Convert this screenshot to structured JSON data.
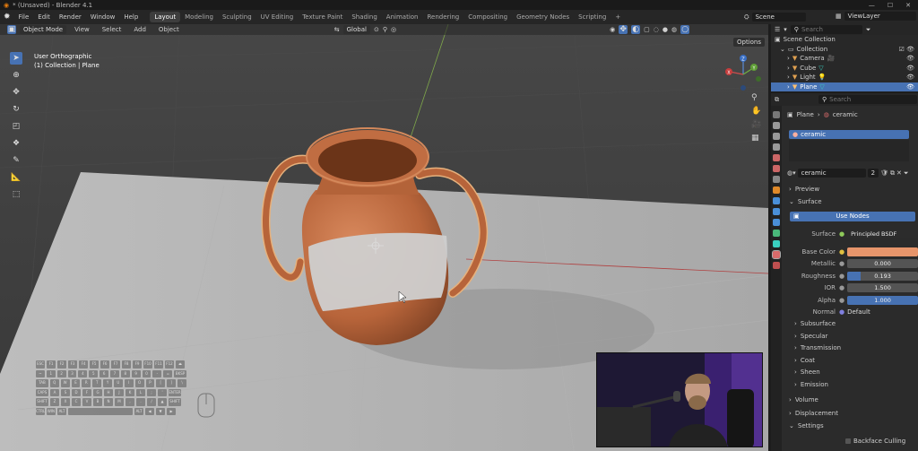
{
  "window": {
    "title": "* (Unsaved) - Blender 4.1",
    "controls": [
      "—",
      "☐",
      "✕"
    ]
  },
  "menu": [
    "File",
    "Edit",
    "Render",
    "Window",
    "Help"
  ],
  "workspaces": [
    "Layout",
    "Modeling",
    "Sculpting",
    "UV Editing",
    "Texture Paint",
    "Shading",
    "Animation",
    "Rendering",
    "Compositing",
    "Geometry Nodes",
    "Scripting"
  ],
  "workspace_add": "+",
  "scene": {
    "name": "Scene",
    "view_layer": "ViewLayer"
  },
  "viewport_header": {
    "mode": "Object Mode",
    "menus": [
      "View",
      "Select",
      "Add",
      "Object"
    ],
    "orientation": "Global",
    "options": "Options"
  },
  "viewport_overlay": {
    "view": "User Orthographic",
    "collection": "(1) Collection | Plane"
  },
  "gizmo": {
    "x": "X",
    "y": "Y",
    "z": "Z"
  },
  "outliner": {
    "search_placeholder": "Search",
    "root": "Scene Collection",
    "collection": "Collection",
    "items": [
      "Camera",
      "Cube",
      "Light",
      "Plane"
    ]
  },
  "properties": {
    "search_placeholder": "Search",
    "breadcrumb_object": "Plane",
    "breadcrumb_material": "ceramic",
    "slot_name": "ceramic",
    "material_name": "ceramic",
    "user_count": "2",
    "preview": "Preview",
    "surface": "Surface",
    "use_nodes": "Use Nodes",
    "surface_label": "Surface",
    "surface_shader": "Principled BSDF",
    "fields": [
      {
        "label": "Base Color",
        "value": "",
        "fill": 1.0
      },
      {
        "label": "Metallic",
        "value": "0.000",
        "fill": 0.0
      },
      {
        "label": "Roughness",
        "value": "0.193",
        "fill": 0.193
      },
      {
        "label": "IOR",
        "value": "1.500",
        "fill": 0.0
      },
      {
        "label": "Alpha",
        "value": "1.000",
        "fill": 1.0
      }
    ],
    "normal_label": "Normal",
    "normal_value": "Default",
    "subpanels": [
      "Subsurface",
      "Specular",
      "Transmission",
      "Coat",
      "Sheen",
      "Emission"
    ],
    "sections": [
      "Volume",
      "Displacement",
      "Settings"
    ],
    "backface": "Backface Culling"
  },
  "colors": {
    "accent": "#4772b3",
    "base_color": "#e7956b",
    "vase": "#b7643a"
  },
  "keyboard": [
    [
      "ESC",
      "F1",
      "F2",
      "F3",
      "F4",
      "F5",
      "F6",
      "F7",
      "F8",
      "F9",
      "F10",
      "F11",
      "F12",
      "⏏"
    ],
    [
      "~",
      "1",
      "2",
      "3",
      "4",
      "5",
      "6",
      "7",
      "8",
      "9",
      "0",
      "-",
      "=",
      "BKSP"
    ],
    [
      "TAB",
      "Q",
      "W",
      "E",
      "R",
      "T",
      "Y",
      "U",
      "I",
      "O",
      "P",
      "[",
      "]",
      "\\"
    ],
    [
      "CAPS",
      "A",
      "S",
      "D",
      "F",
      "G",
      "H",
      "J",
      "K",
      "L",
      ";",
      "'",
      "ENTER"
    ],
    [
      "SHIFT",
      "Z",
      "X",
      "C",
      "V",
      "B",
      "N",
      "M",
      ",",
      ".",
      "/",
      "▲",
      "SHIFT"
    ],
    [
      "CTRL",
      "WIN",
      "ALT",
      "",
      "",
      "",
      "",
      "",
      "",
      "ALT",
      "◀",
      "▼",
      "▶"
    ]
  ]
}
